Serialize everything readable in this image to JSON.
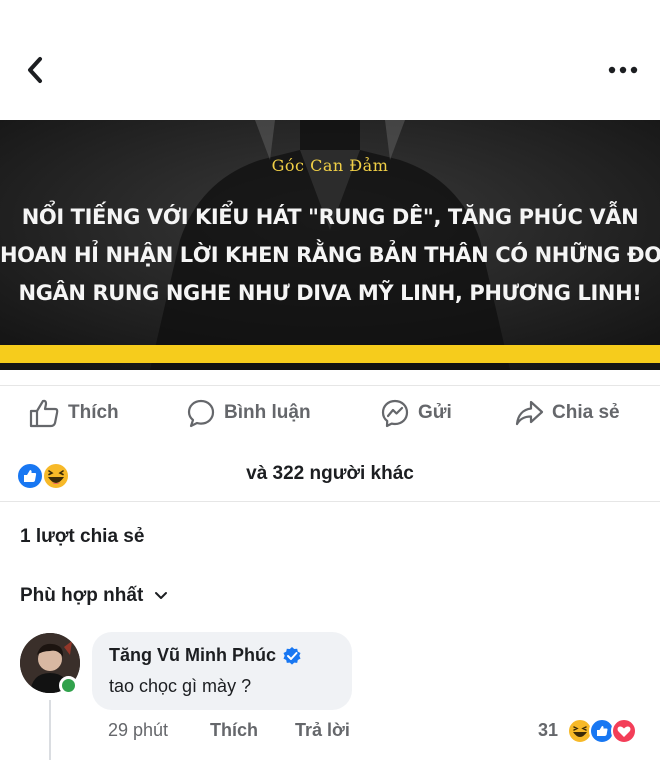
{
  "post": {
    "brand": "Góc Can Đảm",
    "headline_lines": [
      "NỔI TIẾNG VỚI KIỂU HÁT \"RUNG DÊ\", TĂNG PHÚC VẪN",
      "HOAN HỈ NHẬN LỜI KHEN RẰNG BẢN THÂN CÓ NHỮNG ĐOẠN",
      "NGÂN RUNG NGHE NHƯ DIVA MỸ LINH, PHƯƠNG LINH!"
    ]
  },
  "actions": [
    {
      "label": "Thích",
      "icon": "like-icon"
    },
    {
      "label": "Bình luận",
      "icon": "comment-icon"
    },
    {
      "label": "Gửi",
      "icon": "messenger-icon"
    },
    {
      "label": "Chia sẻ",
      "icon": "share-icon"
    }
  ],
  "reactions": {
    "summary": "và 322 người khác",
    "icons": [
      "like-reaction-icon",
      "haha-reaction-icon"
    ]
  },
  "shares": "1 lượt chia sẻ",
  "sort_label": "Phù hợp nhất",
  "comment": {
    "author": "Tăng Vũ Minh Phúc",
    "text": "tao chọc gì mày ?",
    "time": "29 phút",
    "like_label": "Thích",
    "reply_label": "Trả lời",
    "reaction_count": "31",
    "reaction_icons": [
      "haha-reaction-icon",
      "like-reaction-icon",
      "love-reaction-icon"
    ]
  },
  "colors": {
    "accent_yellow": "#f6cc1c",
    "brand_gold": "#f0cf46",
    "facebook_blue": "#1877f2",
    "muted_gray": "#65676b"
  }
}
